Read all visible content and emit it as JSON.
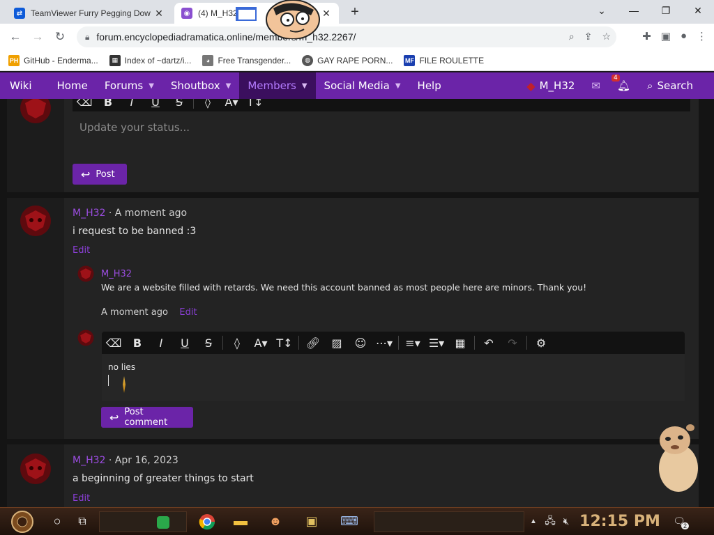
{
  "browser": {
    "tabs": [
      {
        "title": "TeamViewer Furry Pegging Dow",
        "active": false
      },
      {
        "title": "(4) M_H32",
        "active": true
      }
    ],
    "url": "forum.encyclopediadramatica.online/members/m_h32.2267/",
    "bookmarks": [
      {
        "label": "GitHub - Enderma...",
        "icon": "ph-icon",
        "color": "#f0a000"
      },
      {
        "label": "Index of ~dartz/i...",
        "icon": "grid-icon",
        "color": "#333333"
      },
      {
        "label": "Free Transgender...",
        "icon": "cat-icon",
        "color": "#555555"
      },
      {
        "label": "GAY RAPE PORN...",
        "icon": "globe-icon",
        "color": "#555555"
      },
      {
        "label": "FILE ROULETTE",
        "icon": "mf-icon",
        "color": "#1a3fb0"
      }
    ]
  },
  "sitenav": {
    "items": [
      {
        "label": "Wiki",
        "caret": false,
        "selected": false
      },
      {
        "label": "Home",
        "caret": false,
        "selected": false
      },
      {
        "label": "Forums",
        "caret": true,
        "selected": false
      },
      {
        "label": "Shoutbox",
        "caret": true,
        "selected": false
      },
      {
        "label": "Members",
        "caret": true,
        "selected": true
      },
      {
        "label": "Social Media",
        "caret": true,
        "selected": false
      },
      {
        "label": "Help",
        "caret": false,
        "selected": false
      }
    ],
    "user": "M_H32",
    "alerts_count": "4",
    "search_label": "Search"
  },
  "status_box": {
    "placeholder": "Update your status...",
    "post_label": "Post"
  },
  "posts": [
    {
      "author": "M_H32",
      "time": "· A moment ago",
      "text": "i request to be banned :3",
      "edit": "Edit",
      "comment": {
        "author": "M_H32",
        "text": "We are a website filled with retards. We need this account banned as most people here are minors. Thank you!",
        "time": "A moment ago",
        "edit": "Edit"
      },
      "reply_draft": "no lies",
      "post_comment_label": "Post comment"
    },
    {
      "author": "M_H32",
      "time": "· Apr 16, 2023",
      "text": "a beginning of greater things to start",
      "edit": "Edit"
    }
  ],
  "taskbar": {
    "clock": "12:15 PM",
    "notif_count": "2"
  },
  "colors": {
    "accent": "#6b24a8",
    "link": "#9b4de0"
  }
}
